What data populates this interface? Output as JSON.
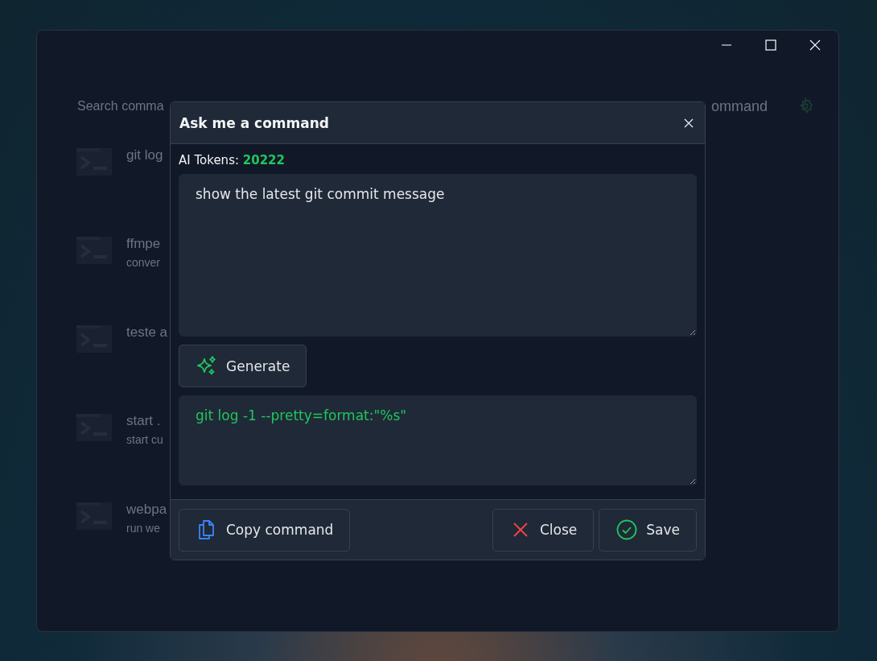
{
  "app": {
    "search": {
      "placeholder": "Search comma"
    },
    "add_button": {
      "label": "ommand"
    },
    "commands": [
      {
        "title": "git log"
      },
      {
        "title": "ffmpe",
        "subtitle": "conver"
      },
      {
        "title": "teste a"
      },
      {
        "title": "start .",
        "subtitle": "start cu"
      },
      {
        "title": "webpa",
        "subtitle": "run we"
      }
    ]
  },
  "dialog": {
    "title": "Ask me a command",
    "tokens_label": "AI Tokens:",
    "tokens_value": "20222",
    "prompt": {
      "value": "show the latest git commit message"
    },
    "generate_button": {
      "label": "Generate"
    },
    "result": {
      "value": "git log -1 --pretty=format:\"%s\""
    },
    "buttons": [
      {
        "kind": "copy",
        "label": "Copy command"
      },
      {
        "kind": "close",
        "label": "Close"
      },
      {
        "kind": "save",
        "label": "Save"
      }
    ]
  }
}
